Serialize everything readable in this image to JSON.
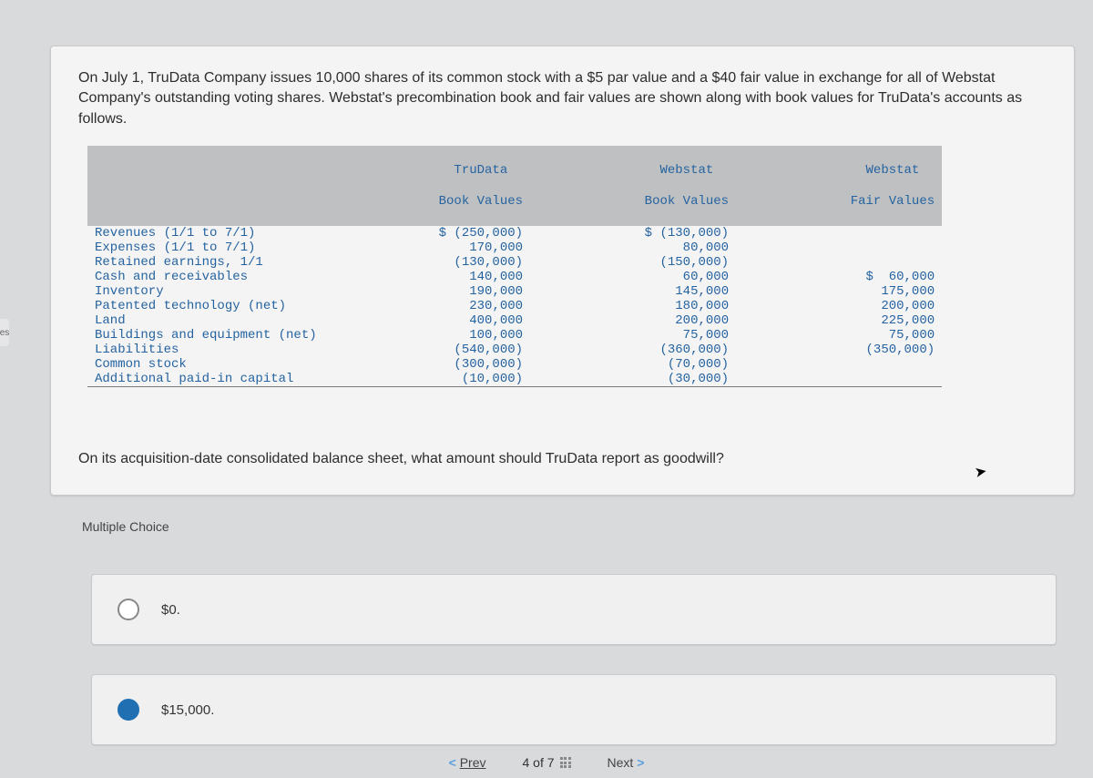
{
  "left_tab_label": "es",
  "intro_text": "On July 1, TruData Company issues 10,000 shares of its common stock with a $5 par value and a $40 fair value in exchange for all of Webstat Company's outstanding voting shares. Webstat's precombination book and fair values are shown along with book values for TruData's accounts as follows.",
  "table": {
    "headers": {
      "col1_l1": "TruData",
      "col1_l2": "Book Values",
      "col2_l1": "Webstat",
      "col2_l2": "Book Values",
      "col3_l1": "Webstat",
      "col3_l2": "Fair Values"
    },
    "rows": [
      {
        "label": "Revenues (1/1 to 7/1)",
        "c1": "$ (250,000)",
        "c2": "$ (130,000)",
        "c3": ""
      },
      {
        "label": "Expenses (1/1 to 7/1)",
        "c1": "170,000",
        "c2": "80,000",
        "c3": ""
      },
      {
        "label": "Retained earnings, 1/1",
        "c1": "(130,000)",
        "c2": "(150,000)",
        "c3": ""
      },
      {
        "label": "Cash and receivables",
        "c1": "140,000",
        "c2": "60,000",
        "c3": "$  60,000"
      },
      {
        "label": "Inventory",
        "c1": "190,000",
        "c2": "145,000",
        "c3": "175,000"
      },
      {
        "label": "Patented technology (net)",
        "c1": "230,000",
        "c2": "180,000",
        "c3": "200,000"
      },
      {
        "label": "Land",
        "c1": "400,000",
        "c2": "200,000",
        "c3": "225,000"
      },
      {
        "label": "Buildings and equipment (net)",
        "c1": "100,000",
        "c2": "75,000",
        "c3": "75,000"
      },
      {
        "label": "Liabilities",
        "c1": "(540,000)",
        "c2": "(360,000)",
        "c3": "(350,000)"
      },
      {
        "label": "Common stock",
        "c1": "(300,000)",
        "c2": "(70,000)",
        "c3": ""
      },
      {
        "label": "Additional paid-in capital",
        "c1": "(10,000)",
        "c2": "(30,000)",
        "c3": ""
      }
    ]
  },
  "question_text": "On its acquisition-date consolidated balance sheet, what amount should TruData report as goodwill?",
  "mc_label": "Multiple Choice",
  "choices": {
    "a": "$0.",
    "b": "$15,000."
  },
  "nav": {
    "prev": "Prev",
    "count": "4 of 7",
    "next": "Next"
  }
}
